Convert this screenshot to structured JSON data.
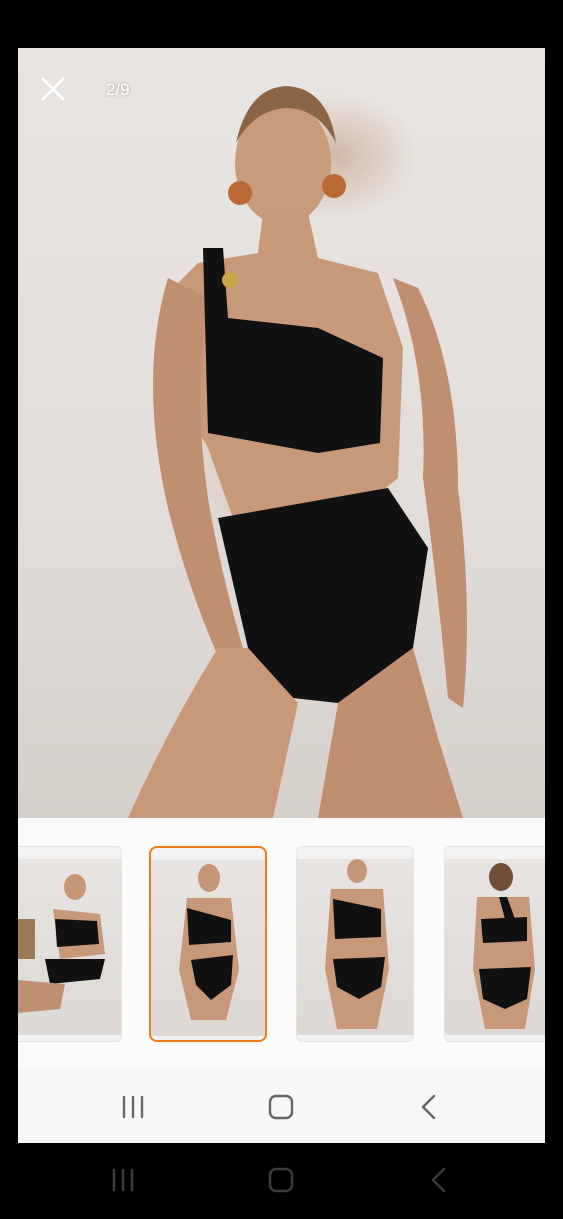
{
  "viewer": {
    "counter": "2/9",
    "close_icon": "close-icon"
  },
  "thumbnails": [
    {
      "name": "thumbnail-1",
      "selected": false
    },
    {
      "name": "thumbnail-2",
      "selected": true
    },
    {
      "name": "thumbnail-3",
      "selected": false
    },
    {
      "name": "thumbnail-4",
      "selected": false
    }
  ],
  "screen_nav": {
    "recents_icon": "recents-icon",
    "home_icon": "home-icon",
    "back_icon": "back-icon"
  },
  "colors": {
    "selected_border": "#f27a1a",
    "garment": "#111111",
    "wall": "#e5e1de"
  }
}
